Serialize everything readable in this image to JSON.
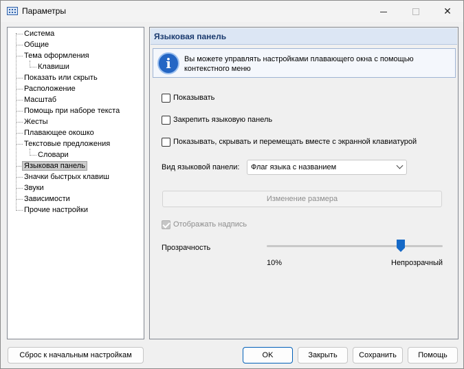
{
  "window": {
    "title": "Параметры",
    "controls": {
      "minimize": "—",
      "maximize": "□",
      "close": "✕"
    }
  },
  "tree": {
    "items": [
      {
        "label": "Система",
        "level": 0
      },
      {
        "label": "Общие",
        "level": 0
      },
      {
        "label": "Тема оформления",
        "level": 0
      },
      {
        "label": "Клавиши",
        "level": 1
      },
      {
        "label": "Показать или скрыть",
        "level": 0
      },
      {
        "label": "Расположение",
        "level": 0
      },
      {
        "label": "Масштаб",
        "level": 0
      },
      {
        "label": "Помощь при наборе текста",
        "level": 0
      },
      {
        "label": "Жесты",
        "level": 0
      },
      {
        "label": "Плавающее окошко",
        "level": 0
      },
      {
        "label": "Текстовые предложения",
        "level": 0
      },
      {
        "label": "Словари",
        "level": 1
      },
      {
        "label": "Языковая панель",
        "level": 0,
        "selected": true
      },
      {
        "label": "Значки быстрых клавиш",
        "level": 0
      },
      {
        "label": "Звуки",
        "level": 0
      },
      {
        "label": "Зависимости",
        "level": 0
      },
      {
        "label": "Прочие настройки",
        "level": 0
      }
    ]
  },
  "panel": {
    "title": "Языковая панель",
    "info_text": "Вы можете управлять настройками плавающего окна с помощью контекстного меню",
    "checkboxes": {
      "show": "Показывать",
      "pin": "Закрепить языковую панель",
      "with_keyboard": "Показывать, скрывать и перемещать вместе с экранной клавиатурой",
      "show_caption": "Отображать надпись"
    },
    "view_label": "Вид языковой панели:",
    "view_value": "Флаг языка с названием",
    "resize_button": "Изменение размера",
    "transparency_label": "Прозрачность",
    "transparency_min": "10%",
    "transparency_max": "Непрозрачный",
    "transparency_level": 0.76
  },
  "buttons": {
    "reset": "Сброс к начальным настройкам",
    "ok": "OK",
    "close": "Закрыть",
    "save": "Сохранить",
    "help": "Помощь"
  },
  "colors": {
    "accent": "#1569c7",
    "header_bg": "#dce6f4",
    "header_text": "#1a3a6e"
  }
}
